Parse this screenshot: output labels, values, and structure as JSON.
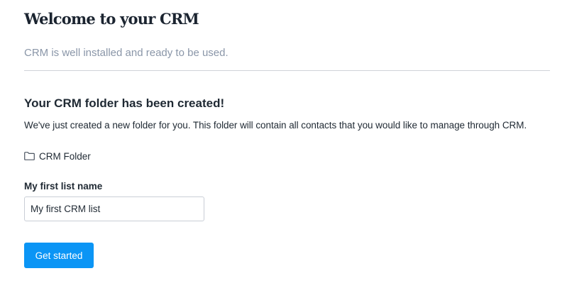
{
  "header": {
    "title": "Welcome to your CRM",
    "subtitle": "CRM is well installed and ready to be used."
  },
  "folder_section": {
    "heading": "Your CRM folder has been created!",
    "description": "We've just created a new folder for you. This folder will contain all contacts that you would like to manage through CRM.",
    "folder_icon": "folder-icon",
    "folder_name": "CRM Folder"
  },
  "list_form": {
    "label": "My first list name",
    "value": "My first CRM list",
    "submit_label": "Get started"
  },
  "colors": {
    "primary_button": "#0b95f5",
    "subtitle_text": "#8a96a8",
    "divider": "#cfd3d8"
  }
}
